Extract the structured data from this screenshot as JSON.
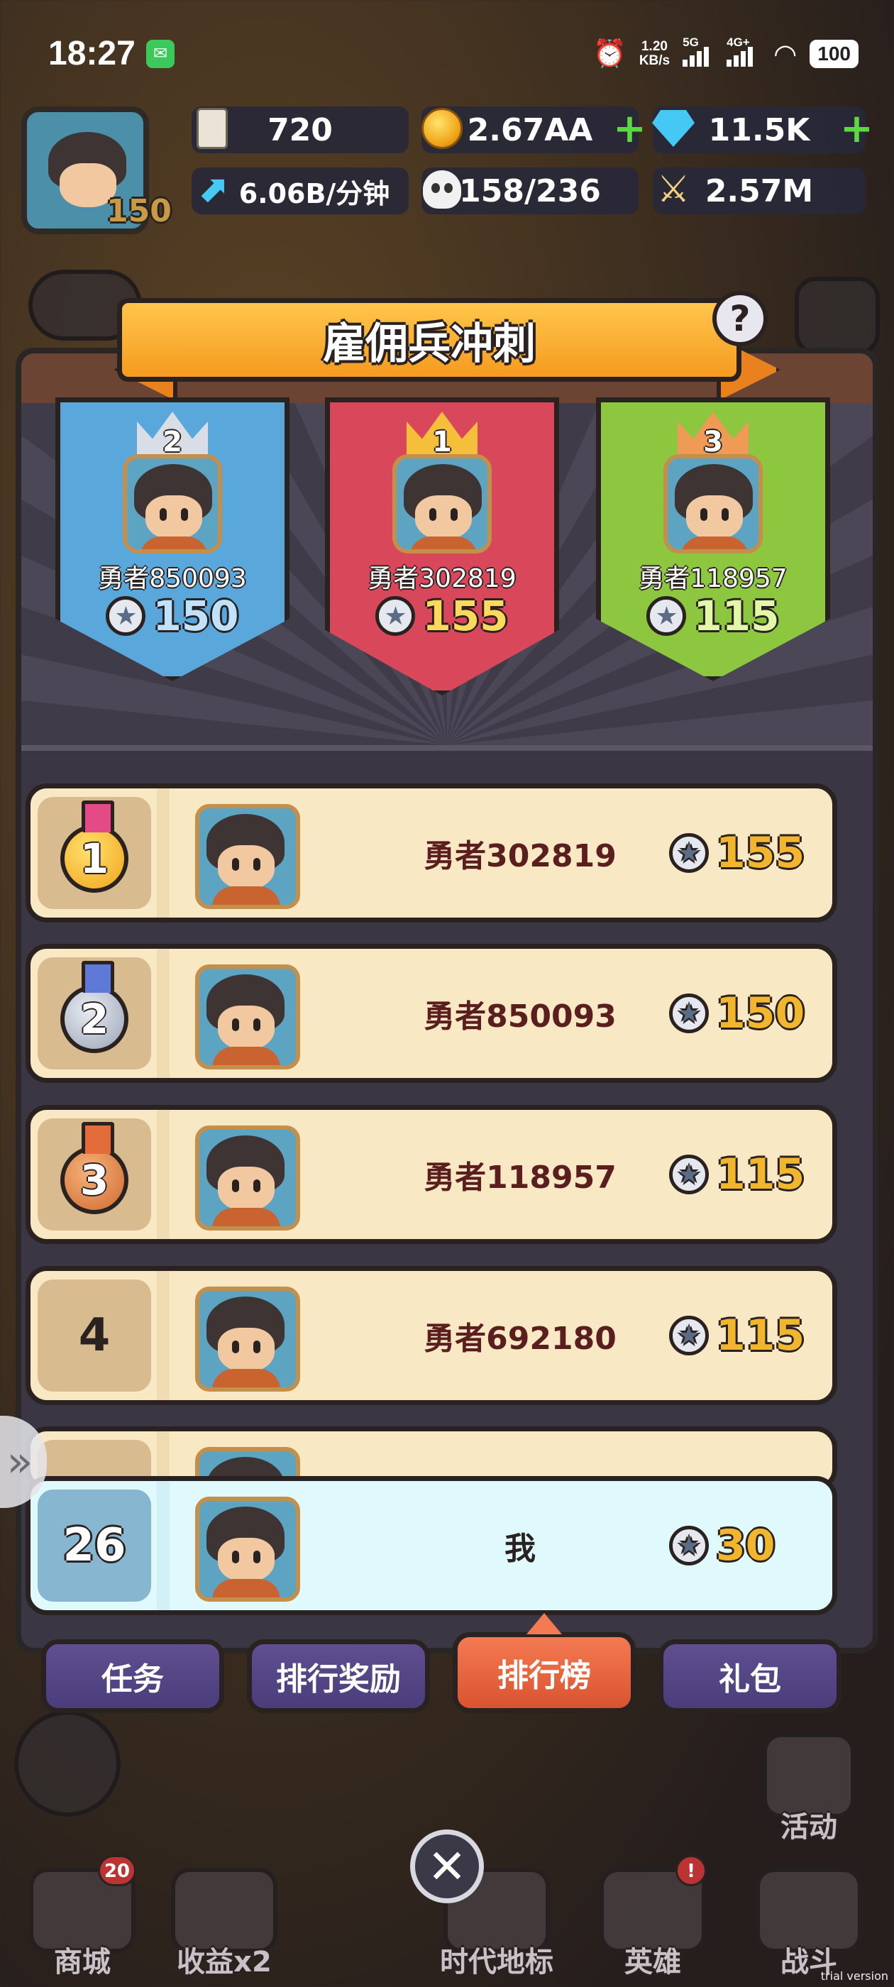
{
  "status_bar": {
    "time": "18:27",
    "network_speed": "1.20",
    "network_speed_unit": "KB/s",
    "signal_1_label": "5G",
    "signal_2_label": "4G+",
    "battery": "100"
  },
  "header": {
    "player_level": "150",
    "resources": {
      "pillar": "720",
      "coins": "2.67AA",
      "gems": "11.5K",
      "income_rate": "6.06B/分钟",
      "population": "158/236",
      "power": "2.57M"
    }
  },
  "event": {
    "title": "雇佣兵冲刺",
    "help_label": "?"
  },
  "podium": [
    {
      "rank": "2",
      "name": "勇者850093",
      "score": "150",
      "color": "#5aa7dc",
      "crown_color": "#d9dde6",
      "score_color": "#bfe3ff"
    },
    {
      "rank": "1",
      "name": "勇者302819",
      "score": "155",
      "color": "#d9485a",
      "crown_color": "#f5bf3b",
      "score_color": "#ffd95c"
    },
    {
      "rank": "3",
      "name": "勇者118957",
      "score": "115",
      "color": "#8dc63f",
      "crown_color": "#ef9b55",
      "score_color": "#e2f7a8"
    }
  ],
  "leaderboard": [
    {
      "rank": "1",
      "name": "勇者302819",
      "score": "155"
    },
    {
      "rank": "2",
      "name": "勇者850093",
      "score": "150"
    },
    {
      "rank": "3",
      "name": "勇者118957",
      "score": "115"
    },
    {
      "rank": "4",
      "name": "勇者692180",
      "score": "115"
    }
  ],
  "my_entry": {
    "rank": "26",
    "name": "我",
    "score": "30"
  },
  "tabs": [
    {
      "label": "任务",
      "active": false
    },
    {
      "label": "排行奖励",
      "active": false
    },
    {
      "label": "排行榜",
      "active": true
    },
    {
      "label": "礼包",
      "active": false
    }
  ],
  "bottom_nav": {
    "activity_label": "活动",
    "shop_label": "商城",
    "shop_badge": "20",
    "income_label": "收益x2",
    "landmark_label": "时代地标",
    "hero_label": "英雄",
    "hero_badge": "!",
    "battle_label": "战斗",
    "close_label": "✕"
  },
  "watermark": "trial version",
  "icons": {
    "alarm": "alarm-icon",
    "wifi": "wifi-icon",
    "star_coin": "star-coin-icon"
  },
  "colors": {
    "score_gold": "#f2b62e",
    "tab_active": "#e0603a",
    "tab_inactive": "#54457f"
  }
}
